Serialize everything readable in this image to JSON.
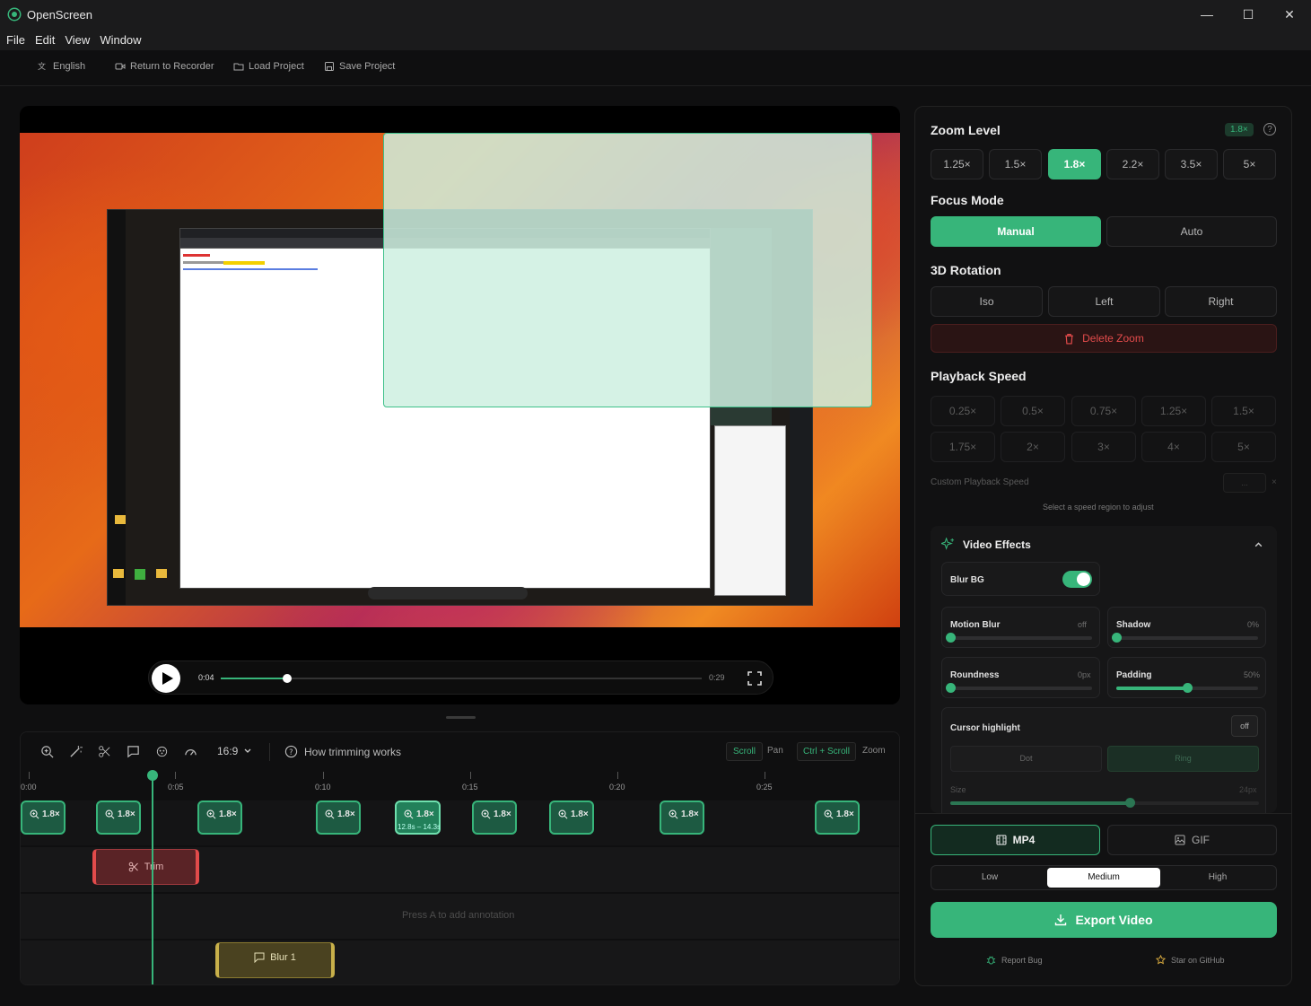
{
  "window": {
    "title": "OpenScreen",
    "min": "—",
    "max": "☐",
    "close": "✕"
  },
  "menu": [
    "File",
    "Edit",
    "View",
    "Window"
  ],
  "toolbar": {
    "language": "English",
    "return": "Return to Recorder",
    "load": "Load Project",
    "save": "Save Project"
  },
  "player": {
    "current": "0:04",
    "duration": "0:29",
    "progress": 0.138
  },
  "timeline": {
    "aspect": "16:9",
    "help": "How trimming works",
    "scroll_key": "Scroll",
    "scroll_action": "Pan",
    "zoom_key": "Ctrl + Scroll",
    "zoom_action": "Zoom",
    "ticks": [
      "0:00",
      "0:05",
      "0:10",
      "0:15",
      "0:20",
      "0:25"
    ],
    "zoom_chip_label": "1.8×",
    "selected_chip_sub": "12.8s – 14.3s",
    "trim_label": "Trim",
    "annotation_hint": "Press A to add annotation",
    "blur_label": "Blur 1"
  },
  "panel": {
    "zoom_title": "Zoom Level",
    "zoom_badge": "1.8×",
    "help_icon": "?",
    "zoom_levels": [
      "1.25×",
      "1.5×",
      "1.8×",
      "2.2×",
      "3.5×",
      "5×"
    ],
    "focus_title": "Focus Mode",
    "focus_manual": "Manual",
    "focus_auto": "Auto",
    "rotation_title": "3D Rotation",
    "rot_iso": "Iso",
    "rot_left": "Left",
    "rot_right": "Right",
    "delete_zoom": "Delete Zoom",
    "speed_title": "Playback Speed",
    "speeds_row1": [
      "0.25×",
      "0.5×",
      "0.75×",
      "1.25×",
      "1.5×"
    ],
    "speeds_row2": [
      "1.75×",
      "2×",
      "3×",
      "4×",
      "5×"
    ],
    "custom_speed": "Custom Playback Speed",
    "custom_placeholder": "...",
    "custom_suffix": "×",
    "speed_hint": "Select a speed region to adjust",
    "effects_title": "Video Effects",
    "blur_bg": "Blur BG",
    "motion_blur": "Motion Blur",
    "motion_blur_val": "off",
    "motion_blur_level": 0,
    "shadow": "Shadow",
    "shadow_val": "0%",
    "shadow_level": 0,
    "roundness": "Roundness",
    "roundness_val": "0px",
    "roundness_level": 0,
    "padding": "Padding",
    "padding_val": "50%",
    "padding_level": 0.5,
    "cursor_title": "Cursor highlight",
    "cursor_toggle": "off",
    "cursor_dot": "Dot",
    "cursor_ring": "Ring",
    "size": "Size",
    "size_val": "24px",
    "size_level": 0.58,
    "fmt_mp4": "MP4",
    "fmt_gif": "GIF",
    "quality": [
      "Low",
      "Medium",
      "High"
    ],
    "export": "Export Video",
    "report": "Report Bug",
    "star": "Star on GitHub"
  },
  "colors": {
    "accent": "#37b57a",
    "danger": "#e24b4b",
    "blur": "#c8b04a"
  }
}
